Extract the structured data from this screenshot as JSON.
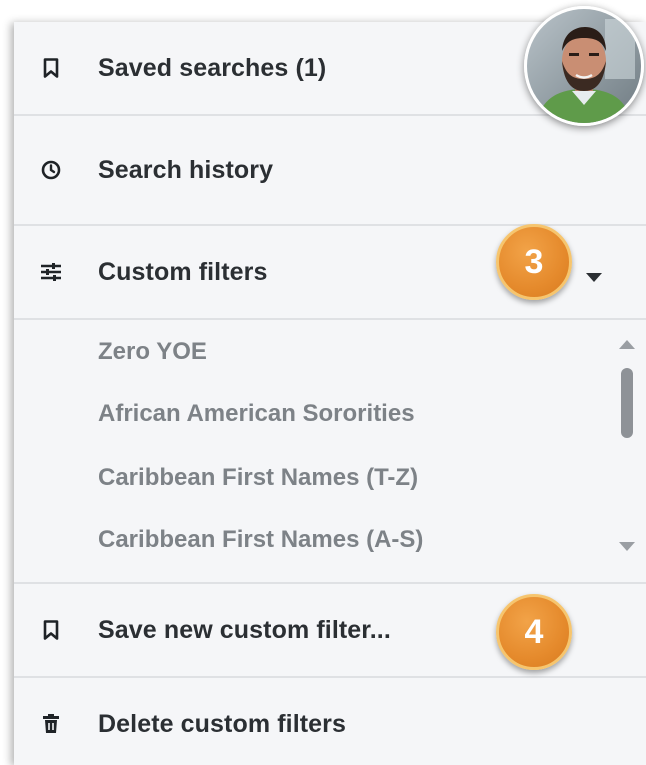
{
  "menu": {
    "saved_searches": {
      "label": "Saved searches (1)",
      "icon": "bookmark-icon"
    },
    "search_history": {
      "label": "Search history",
      "icon": "clock-icon"
    },
    "custom_filters": {
      "label": "Custom filters",
      "icon": "sliders-icon",
      "expanded": true
    },
    "save_new_filter": {
      "label": "Save new custom filter...",
      "icon": "bookmark-icon"
    },
    "delete_filters": {
      "label": "Delete custom filters",
      "icon": "trash-icon"
    }
  },
  "custom_filter_items": [
    "Zero YOE",
    "African American Sororities",
    "Caribbean First Names (T-Z)",
    "Caribbean First Names (A-S)"
  ],
  "callouts": [
    "3",
    "4"
  ],
  "colors": {
    "panel_bg": "#f5f6f8",
    "text_primary": "#2b2f33",
    "text_muted": "#7d8287",
    "divider": "#dfe1e4",
    "callout": "#e58a2c"
  }
}
